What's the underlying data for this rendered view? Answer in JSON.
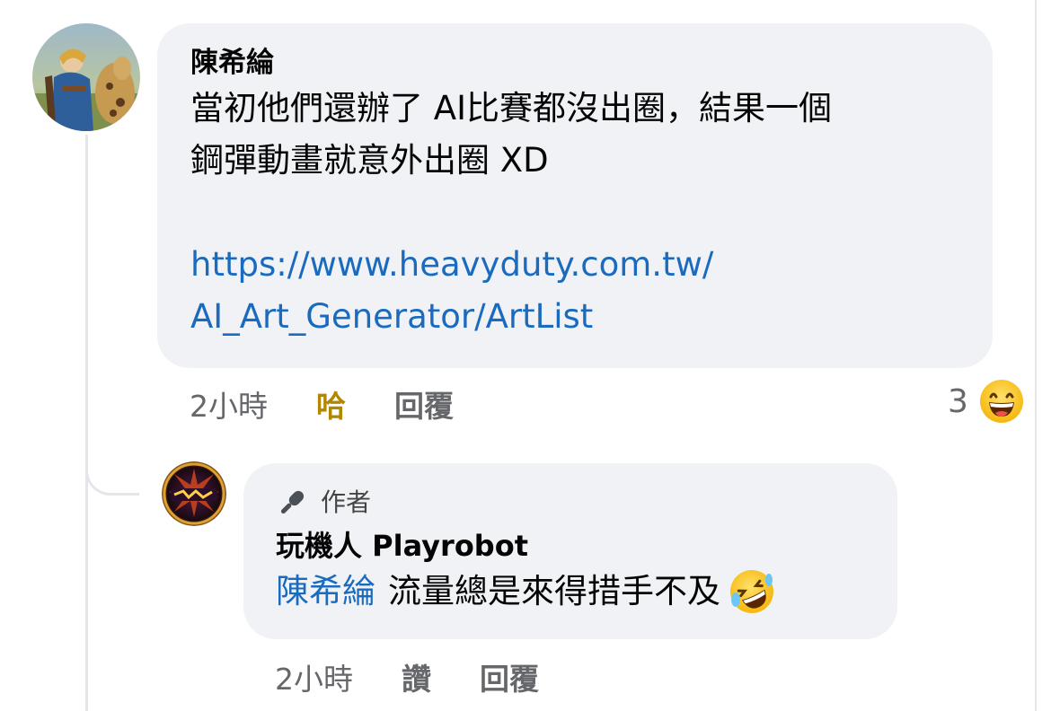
{
  "comment": {
    "author": "陳希綸",
    "text": "當初他們還辦了 AI比賽都沒出圈，結果一個鋼彈動畫就意外出圈 XD",
    "text_line1": "當初他們還辦了 AI比賽都沒出圈，結果一個",
    "text_line2": "鋼彈動畫就意外出圈 XD",
    "link_line1": "https://www.heavyduty.com.tw/",
    "link_line2": "AI_Art_Generator/ArtList",
    "time": "2小時",
    "reaction_label": "哈",
    "reply_label": "回覆",
    "reaction_count": "3",
    "reaction_icon": "laughing-emoji-icon"
  },
  "reply": {
    "badge": "作者",
    "badge_icon": "microphone-icon",
    "author": "玩機人 Playrobot",
    "mention": "陳希綸",
    "text": "流量總是來得措手不及",
    "emoji": "rolling-on-floor-laughing-icon",
    "time": "2小時",
    "like_label": "讚",
    "reply_label": "回覆"
  },
  "colors": {
    "bubble": "#f0f2f5",
    "link": "#1a6bbf",
    "meta": "#65676b",
    "haha": "#b38600"
  }
}
